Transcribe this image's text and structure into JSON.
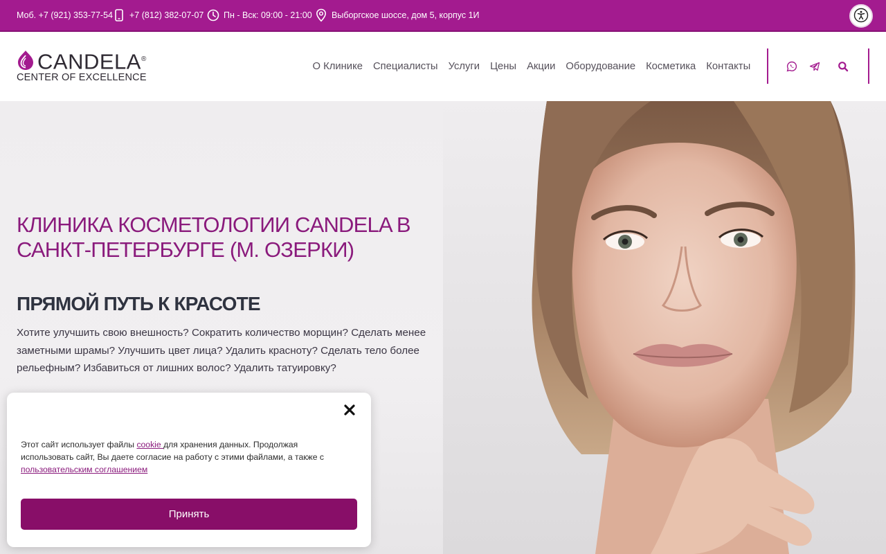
{
  "topbar": {
    "mobile": "Моб. +7 (921) 353-77-54",
    "phone": "+7 (812) 382-07-07",
    "hours": "Пн - Вск: 09:00 - 21:00",
    "address": "Выборгское шоссе, дом 5, корпус 1И",
    "icons": {
      "phone": "smartphone-icon",
      "hours": "clock-icon",
      "address": "map-pin-icon",
      "accessibility": "accessibility-icon"
    }
  },
  "header": {
    "logo_word": "CANDELA",
    "logo_registered": "®",
    "logo_sub": "CENTER OF EXCELLENCE",
    "nav": [
      "О Клинике",
      "Специалисты",
      "Услуги",
      "Цены",
      "Акции",
      "Оборудование",
      "Косметика",
      "Контакты"
    ],
    "icons": {
      "whatsapp": "whatsapp-icon",
      "telegram": "telegram-icon",
      "search": "search-icon"
    }
  },
  "hero": {
    "title": "КЛИНИКА КОСМЕТОЛОГИИ CANDELA В САНКТ-ПЕТЕРБУРГЕ (М. ОЗЕРКИ)",
    "subtitle": "ПРЯМОЙ ПУТЬ К КРАСОТЕ",
    "text": "Хотите улучшить свою внешность? Сократить количество морщин? Сделать менее заметными шрамы? Улучшить цвет лица? Удалить красноту? Сделать тело более рельефным? Избавиться от лишних волос? Удалить татуировку?"
  },
  "cookie": {
    "text_1": "Этот сайт использует файлы ",
    "link_cookie": "cookie ",
    "text_2": "для хранения данных. Продолжая использовать сайт, Вы даете согласие на работу с этими файлами, а также с ",
    "link_agreement": "пользовательским соглашением",
    "accept": "Принять",
    "close_icon": "close-icon"
  },
  "colors": {
    "brand": "#a31b8f",
    "brand_dark": "#880e68",
    "title": "#8a1a7c"
  }
}
